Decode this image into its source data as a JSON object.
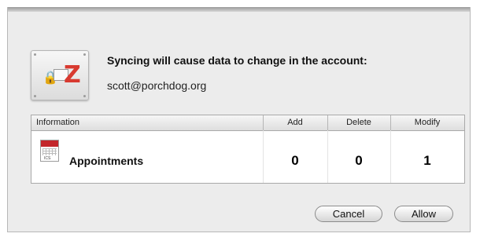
{
  "dialog": {
    "message": "Syncing will cause data to change in the account:",
    "account": "scott@porchdog.org"
  },
  "app_icon": {
    "lettering": "Z",
    "color": "#d83a30",
    "symbols": [
      "lock-icon",
      "envelope-icon"
    ]
  },
  "table": {
    "columns": [
      "Information",
      "Add",
      "Delete",
      "Modify"
    ],
    "rows": [
      {
        "label": "Appointments",
        "icon": "calendar-icon",
        "add": "0",
        "delete": "0",
        "modify": "1"
      }
    ]
  },
  "buttons": {
    "cancel": "Cancel",
    "allow": "Allow"
  }
}
